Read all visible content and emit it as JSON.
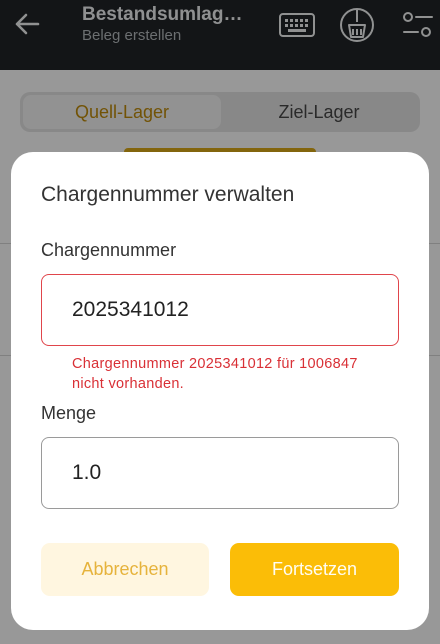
{
  "header": {
    "title": "Bestandsumlag…",
    "subtitle": "Beleg erstellen",
    "icons": [
      "back-arrow",
      "keyboard",
      "broom",
      "settings-sliders"
    ]
  },
  "segment": {
    "left_label": "Quell-Lager",
    "right_label": "Ziel-Lager",
    "active": "left"
  },
  "dialog": {
    "title": "Chargennummer verwalten",
    "batch_label": "Chargennummer",
    "batch_value": "2025341012",
    "error": "Chargennummer 2025341012 für 1006847 nicht vorhanden.",
    "quantity_label": "Menge",
    "quantity_value": "1.0",
    "cancel_label": "Abbrechen",
    "continue_label": "Fortsetzen"
  },
  "colors": {
    "accent": "#fbbd07",
    "error": "#d93036",
    "appbar": "#1f2326"
  }
}
